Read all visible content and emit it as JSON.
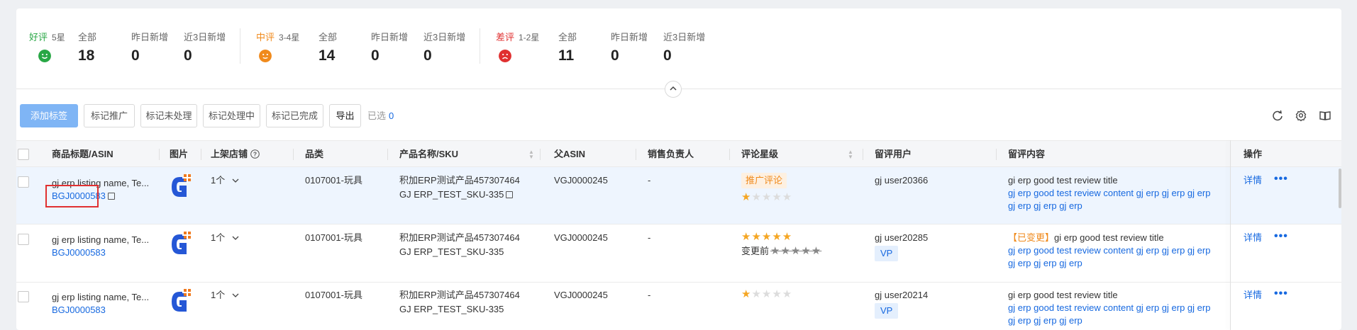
{
  "stats": {
    "good": {
      "label": "好评",
      "stars": "5星",
      "color": "#28a745",
      "all_label": "全部",
      "all": "18",
      "yesterday_label": "昨日新增",
      "yesterday": "0",
      "three_day_label": "近3日新增",
      "three_day": "0"
    },
    "mid": {
      "label": "中评",
      "stars": "3-4星",
      "color": "#f08a1c",
      "all_label": "全部",
      "all": "14",
      "yesterday_label": "昨日新增",
      "yesterday": "0",
      "three_day_label": "近3日新增",
      "three_day": "0"
    },
    "bad": {
      "label": "差评",
      "stars": "1-2星",
      "color": "#e03030",
      "all_label": "全部",
      "all": "11",
      "yesterday_label": "昨日新增",
      "yesterday": "0",
      "three_day_label": "近3日新增",
      "three_day": "0"
    }
  },
  "toolbar": {
    "add_tag": "添加标签",
    "mark_promo": "标记推广",
    "mark_unprocessed": "标记未处理",
    "mark_processing": "标记处理中",
    "mark_done": "标记已完成",
    "export": "导出",
    "selected_label": "已选",
    "selected_count": "0",
    "icons": [
      "refresh-icon",
      "settings-icon",
      "columns-icon"
    ]
  },
  "table": {
    "headers": {
      "title_asin": "商品标题/ASIN",
      "image": "图片",
      "store": "上架店铺",
      "category": "品类",
      "product_sku": "产品名称/SKU",
      "parent_asin": "父ASIN",
      "sales_owner": "销售负责人",
      "rating": "评论星级",
      "reviewer": "留评用户",
      "content": "留评内容",
      "actions": "操作"
    },
    "rows": [
      {
        "title": "gj erp listing name, Te...",
        "asin": "BGJ0000583",
        "store": "1个",
        "category": "0107001-玩具",
        "product_name": "积加ERP测试产品457307464",
        "sku": "GJ ERP_TEST_SKU-335",
        "parent_asin": "VGJ0000245",
        "sales_owner": "-",
        "tag": "推广评论",
        "stars": 1,
        "reviewer": "gj user20366",
        "badge": "",
        "content_prefix": "",
        "content_title": "gi erp good test review title",
        "content_body": "gj erp good test review content gj erp gj erp gj erp",
        "content_body2": "gj erp gj erp gj erp",
        "detail": "详情",
        "more": "•••"
      },
      {
        "title": "gj erp listing name, Te...",
        "asin": "BGJ0000583",
        "store": "1个",
        "category": "0107001-玩具",
        "product_name": "积加ERP测试产品457307464",
        "sku": "GJ ERP_TEST_SKU-335",
        "parent_asin": "VGJ0000245",
        "sales_owner": "-",
        "stars": 5,
        "before_label": "变更前",
        "reviewer": "gj user20285",
        "badge": "VP",
        "content_prefix": "【已变更】",
        "content_title": "gi erp good test review title",
        "content_body": "gj erp good test review content gj erp gj erp gj erp",
        "content_body2": "gj erp gj erp gj erp",
        "detail": "详情",
        "more": "•••"
      },
      {
        "title": "gj erp listing name, Te...",
        "asin": "BGJ0000583",
        "store": "1个",
        "category": "0107001-玩具",
        "product_name": "积加ERP测试产品457307464",
        "sku": "GJ ERP_TEST_SKU-335",
        "parent_asin": "VGJ0000245",
        "sales_owner": "-",
        "stars": 1,
        "reviewer": "gj user20214",
        "badge": "VP",
        "content_prefix": "",
        "content_title": "gi erp good test review title",
        "content_body": "gj erp good test review content gj erp gj erp gj erp",
        "content_body2": "gj erp gj erp gj erp",
        "detail": "详情",
        "more": "•••"
      }
    ]
  },
  "collapse_icon": "chevron-up-icon"
}
